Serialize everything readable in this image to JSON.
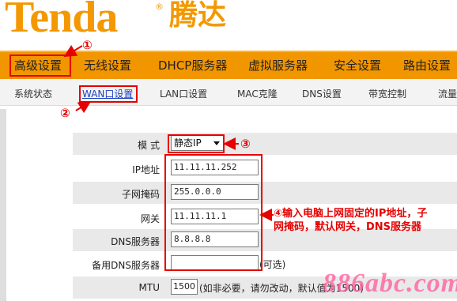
{
  "header": {
    "logo_text": "Tenda",
    "logo_reg": "®",
    "logo_cn": "腾达"
  },
  "main_nav": {
    "items": [
      {
        "label": "高级设置"
      },
      {
        "label": "无线设置"
      },
      {
        "label": "DHCP服务器"
      },
      {
        "label": "虚拟服务器"
      },
      {
        "label": "安全设置"
      },
      {
        "label": "路由设置"
      }
    ]
  },
  "sub_nav": {
    "items": [
      {
        "label": "系统状态"
      },
      {
        "label": "WAN口设置"
      },
      {
        "label": "LAN口设置"
      },
      {
        "label": "MAC克隆"
      },
      {
        "label": "DNS设置"
      },
      {
        "label": "带宽控制"
      },
      {
        "label": "流量"
      }
    ]
  },
  "form": {
    "mode": {
      "label": "模 式",
      "value": "静态IP"
    },
    "ip": {
      "label": "IP地址",
      "value": "11.11.11.252"
    },
    "mask": {
      "label": "子网掩码",
      "value": "255.0.0.0"
    },
    "gateway": {
      "label": "网关",
      "value": "11.11.11.1"
    },
    "dns": {
      "label": "DNS服务器",
      "value": "8.8.8.8"
    },
    "dns2": {
      "label": "备用DNS服务器",
      "value": "",
      "note": "(可选)"
    },
    "mtu": {
      "label": "MTU",
      "value": "1500",
      "note": "(如非必要，请勿改动，默认值为1500)"
    }
  },
  "annotations": {
    "n1": "①",
    "n2": "②",
    "n3": "③",
    "n4_text": "④输入电脑上网固定的IP地址，子网掩码，默认网关，DNS服务器"
  },
  "watermark": "886abc.com",
  "colors": {
    "brand_orange": "#f39800",
    "nav_orange": "#f29600",
    "annotation_red": "#e60000"
  }
}
